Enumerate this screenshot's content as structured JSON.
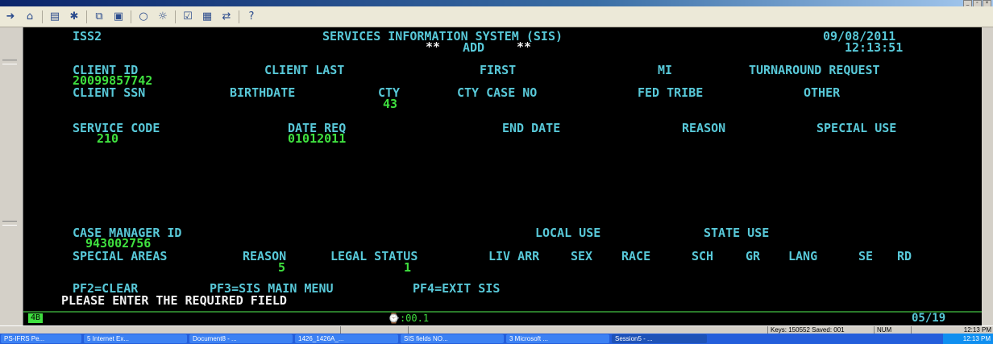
{
  "toolbar": {
    "icons": [
      "arrow-right-icon",
      "home-icon",
      "new-icon",
      "connect-icon",
      "copy-icon",
      "paste-icon",
      "circle-icon",
      "macro-icon",
      "check-icon",
      "chart-icon",
      "transfer-icon",
      "help-icon"
    ]
  },
  "screen": {
    "session": "ISS2",
    "title": "SERVICES INFORMATION SYSTEM (SIS)",
    "mode_stars_left": "**",
    "mode": "ADD",
    "mode_stars_right": "**",
    "date": "09/08/2011",
    "time": "12:13:51",
    "labels": {
      "client_id": "CLIENT ID",
      "client_last": "CLIENT LAST",
      "first": "FIRST",
      "mi": "MI",
      "turnaround_request": "TURNAROUND REQUEST",
      "client_ssn": "CLIENT SSN",
      "birthdate": "BIRTHDATE",
      "cty": "CTY",
      "cty_case_no": "CTY CASE NO",
      "fed_tribe": "FED TRIBE",
      "other": "OTHER",
      "service_code": "SERVICE CODE",
      "date_req": "DATE REQ",
      "end_date": "END DATE",
      "reason": "REASON",
      "special_use": "SPECIAL USE",
      "case_manager_id": "CASE MANAGER ID",
      "local_use": "LOCAL USE",
      "state_use": "STATE USE",
      "special_areas": "SPECIAL AREAS",
      "reason2": "REASON",
      "legal_status": "LEGAL STATUS",
      "liv_arr": "LIV ARR",
      "sex": "SEX",
      "race": "RACE",
      "sch": "SCH",
      "gr": "GR",
      "lang": "LANG",
      "se": "SE",
      "rd": "RD"
    },
    "values": {
      "client_id": "20099857742",
      "cty": "43",
      "service_code": "210",
      "date_req": "01012011",
      "case_manager_id": "943002756",
      "reason": "5",
      "legal_status": "1"
    },
    "pf_keys": {
      "pf2": "PF2=CLEAR",
      "pf3": "PF3=SIS MAIN MENU",
      "pf4": "PF4=EXIT SIS"
    },
    "message": "PLEASE ENTER THE REQUIRED FIELD"
  },
  "oia": {
    "indicator": "4B",
    "timer": ":00.1",
    "cursor_pos": "05/19"
  },
  "status": {
    "keys": "Keys: 150552  Saved: 001",
    "num": "NUM",
    "time": "12:13 PM"
  },
  "taskbar": {
    "items": [
      "PS-IFRS Pe...",
      "5 Internet Ex...",
      "Document8 - ...",
      "1426_1426A_...",
      "SIS fields NO...",
      "3 Microsoft ...",
      "Session5 - ..."
    ],
    "clock": "12:13 PM"
  }
}
